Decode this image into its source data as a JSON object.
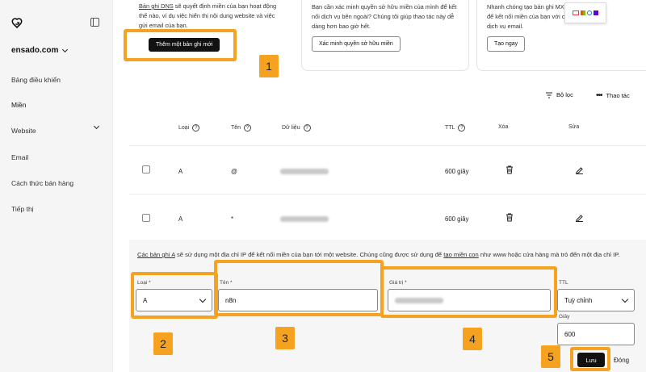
{
  "sidebar": {
    "domain": "ensado.com",
    "items": [
      {
        "label": "Bảng điều khiển"
      },
      {
        "label": "Miền"
      },
      {
        "label": "Website"
      },
      {
        "label": "Email"
      },
      {
        "label": "Cách thức bán hàng"
      },
      {
        "label": "Tiếp thị"
      }
    ]
  },
  "cards": [
    {
      "link": "Bản ghi DNS",
      "text": " sẽ quyết định miền của bạn hoạt động thế nào, ví dụ việc hiển thị nội dung website và việc gửi email của bạn.",
      "button": "Thêm một bản ghi mới"
    },
    {
      "text": "Bạn cần xác minh quyền sở hữu miền của mình để kết nối dịch vụ bên ngoài? Chúng tôi giúp thao tác này dễ dàng hơn bao giờ hết.",
      "button": "Xác minh quyền sở hữu miền"
    },
    {
      "text": "Nhanh chóng tạo bản ghi MX để kết nối miền của bạn với các dịch vụ email.",
      "button": "Tạo ngay"
    }
  ],
  "toolbar": {
    "filter": "Bộ lọc",
    "actions": "Thao tác"
  },
  "table": {
    "headers": {
      "type": "Loại",
      "name": "Tên",
      "data": "Dữ liệu",
      "ttl": "TTL",
      "delete": "Xóa",
      "edit": "Sửa"
    },
    "rows": [
      {
        "type": "A",
        "name": "@",
        "ttl": "600 giây"
      },
      {
        "type": "A",
        "name": "*",
        "ttl": "600 giây"
      }
    ]
  },
  "form": {
    "info_link1": "Các bản ghi A",
    "info_mid": " sẽ sử dụng một địa chỉ IP để kết nối miền của bạn tới một website. Chúng cũng được sử dụng để ",
    "info_link2": "tạo miền con",
    "info_end": " như www hoặc cửa hàng mà trỏ đến một địa chỉ IP.",
    "type_label": "Loại *",
    "type_value": "A",
    "name_label": "Tên *",
    "name_value": "n8n",
    "value_label": "Giá trị *",
    "ttl_label": "TTL",
    "ttl_value": "Tuỳ chỉnh",
    "seconds_label": "Giây",
    "seconds_value": "600",
    "save": "Lưu",
    "close": "Đóng"
  },
  "badges": [
    "1",
    "2",
    "3",
    "4",
    "5"
  ],
  "colors": {
    "highlight": "#f4a21f",
    "sidebar_bg": "#f5f5f5",
    "button_dark": "#111111"
  }
}
